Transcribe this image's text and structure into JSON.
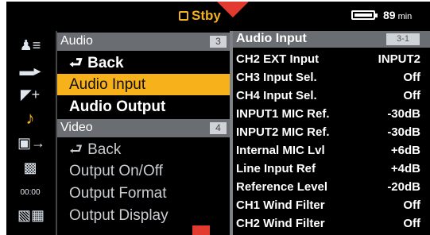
{
  "status": {
    "mode": "Stby",
    "battery_minutes": "89",
    "battery_unit": "min"
  },
  "icons": [
    "user-menu-icon",
    "camera-icon",
    "paint-icon",
    "audio-note-icon",
    "output-icon",
    "media-icon",
    "timecode-icon",
    "settings-icon"
  ],
  "menu": {
    "audio_section": {
      "label": "Audio",
      "number": "3"
    },
    "audio_items": [
      {
        "label": "Back"
      },
      {
        "label": "Audio Input"
      },
      {
        "label": "Audio Output"
      }
    ],
    "video_section": {
      "label": "Video",
      "number": "4"
    },
    "video_items": [
      {
        "label": "Back"
      },
      {
        "label": "Output On/Off"
      },
      {
        "label": "Output Format"
      },
      {
        "label": "Output Display"
      }
    ]
  },
  "panel": {
    "title": "Audio Input",
    "page": "3-1",
    "rows": [
      {
        "label": "CH2 EXT Input",
        "value": "INPUT2"
      },
      {
        "label": "CH3 Input Sel.",
        "value": "Off"
      },
      {
        "label": "CH4 Input Sel.",
        "value": "Off"
      },
      {
        "label": "INPUT1 MIC Ref.",
        "value": "-30dB"
      },
      {
        "label": "INPUT2 MIC Ref.",
        "value": "-30dB"
      },
      {
        "label": "Internal MIC Lvl",
        "value": "+6dB"
      },
      {
        "label": "Line Input Ref",
        "value": "+4dB"
      },
      {
        "label": "Reference Level",
        "value": "-20dB"
      },
      {
        "label": "CH1 Wind Filter",
        "value": "Off"
      },
      {
        "label": "CH2 Wind Filter",
        "value": "Off"
      }
    ]
  }
}
